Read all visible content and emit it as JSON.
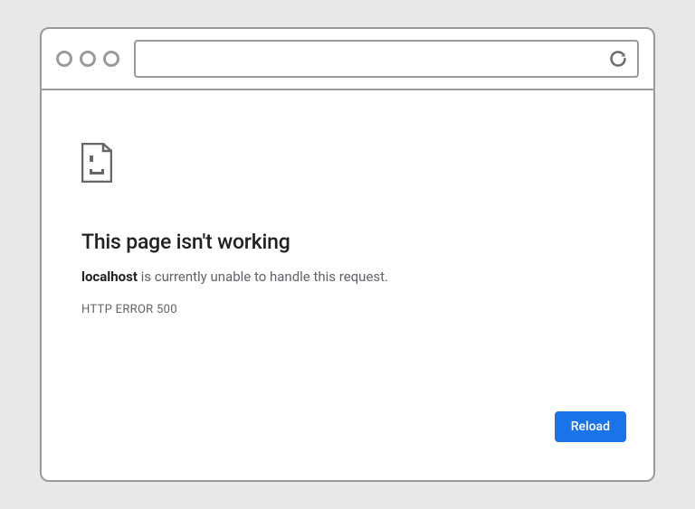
{
  "toolbar": {
    "address_value": ""
  },
  "error": {
    "title": "This page isn't working",
    "host": "localhost",
    "description_suffix": " is currently unable to handle this request.",
    "code": "HTTP ERROR 500",
    "reload_label": "Reload"
  }
}
